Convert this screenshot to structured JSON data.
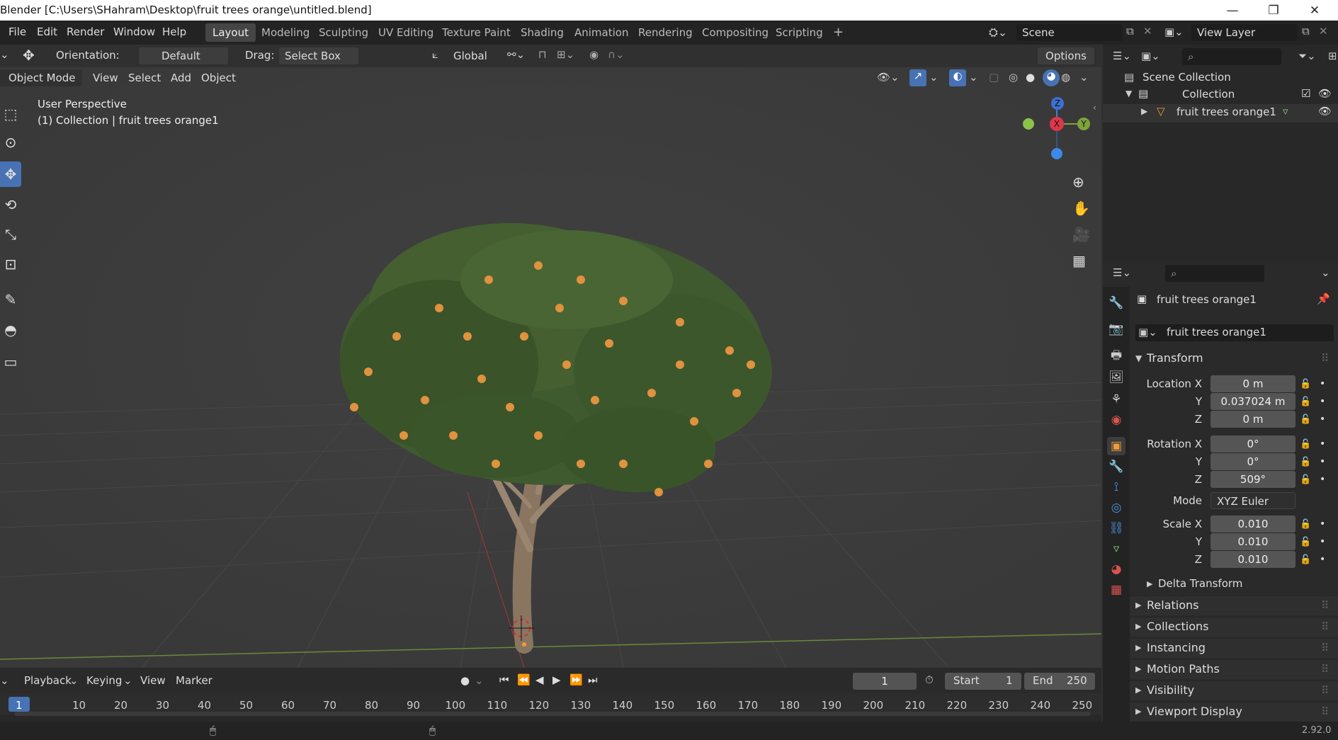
{
  "title_bar": {
    "title": "Blender [C:\\Users\\SHahram\\Desktop\\fruit trees orange\\untitled.blend]",
    "minimize": "—",
    "maximize": "❐",
    "close": "✕"
  },
  "menu": [
    "File",
    "Edit",
    "Render",
    "Window",
    "Help"
  ],
  "workspaces": [
    "Layout",
    "Modeling",
    "Sculpting",
    "UV Editing",
    "Texture Paint",
    "Shading",
    "Animation",
    "Rendering",
    "Compositing",
    "Scripting"
  ],
  "workspace_add": "+",
  "scene": {
    "label": "Scene"
  },
  "view_layer": {
    "label": "View Layer"
  },
  "tool_header": {
    "orientation_label": "Orientation:",
    "orientation_value": "Default",
    "drag_label": "Drag:",
    "drag_value": "Select Box",
    "transform_orientation": "Global",
    "options": "Options"
  },
  "viewport_header": {
    "mode": "Object Mode",
    "menus": [
      "View",
      "Select",
      "Add",
      "Object"
    ]
  },
  "viewport": {
    "perspective": "User Perspective",
    "collection_info": "(1) Collection | fruit trees orange1",
    "gizmo_x": "X",
    "gizmo_y": "Y",
    "gizmo_z": "Z"
  },
  "outliner": {
    "scene_collection": "Scene Collection",
    "collection": "Collection",
    "object": "fruit trees orange1"
  },
  "properties": {
    "object_name": "fruit trees orange1",
    "data_name": "fruit trees orange1",
    "transform_title": "Transform",
    "location_label": "Location X",
    "location": {
      "x": "0 m",
      "y": "0.037024 m",
      "z": "0 m"
    },
    "rotation_label": "Rotation X",
    "rotation": {
      "x": "0°",
      "y": "0°",
      "z": "509°"
    },
    "mode_label": "Mode",
    "mode_value": "XYZ Euler",
    "scale_label": "Scale X",
    "scale": {
      "x": "0.010",
      "y": "0.010",
      "z": "0.010"
    },
    "y_label": "Y",
    "z_label": "Z",
    "delta_transform": "Delta Transform",
    "panels": [
      "Relations",
      "Collections",
      "Instancing",
      "Motion Paths",
      "Visibility",
      "Viewport Display"
    ]
  },
  "timeline": {
    "menus": [
      "Playback",
      "Keying",
      "View",
      "Marker"
    ],
    "current_frame": "1",
    "start_label": "Start",
    "start_value": "1",
    "end_label": "End",
    "end_value": "250",
    "ticks": [
      "1",
      "10",
      "20",
      "30",
      "40",
      "50",
      "60",
      "70",
      "80",
      "90",
      "100",
      "110",
      "120",
      "130",
      "140",
      "150",
      "160",
      "170",
      "180",
      "190",
      "200",
      "210",
      "220",
      "230",
      "240",
      "250"
    ]
  },
  "status_bar": {
    "version": "2.92.0"
  },
  "colors": {
    "accent": "#4772b3",
    "header": "#303030",
    "viewport": "#3c3c3c",
    "panel": "#2a2a2a",
    "orange": "#f29c38"
  }
}
